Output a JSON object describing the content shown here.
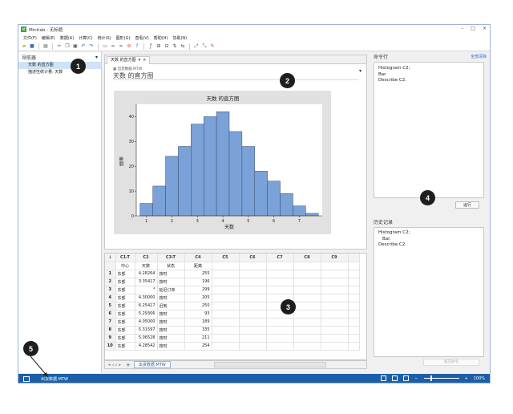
{
  "window": {
    "title": "Minitab - 无标题"
  },
  "menu": [
    "文件(F)",
    "编辑(E)",
    "数据(A)",
    "计算(C)",
    "统计(S)",
    "图形(G)",
    "查看(V)",
    "帮助(H)",
    "协助(N)"
  ],
  "navigator": {
    "title": "导航器",
    "items": [
      "天数 的直方图",
      "描述性统计量: 天数"
    ]
  },
  "output": {
    "tab_label": "天数 的直方图",
    "file_name": "出货数据.MTW",
    "doc_title": "天数 的直方图"
  },
  "chart_data": {
    "type": "bar",
    "title": "天数 的直方图",
    "xlabel": "天数",
    "ylabel": "频率",
    "bin_start": 0.75,
    "bin_width": 0.5,
    "values": [
      5,
      12,
      24,
      28,
      37,
      40,
      42,
      34,
      28,
      18,
      14,
      9,
      4,
      1
    ],
    "xticks": [
      1,
      2,
      3,
      4,
      5,
      6,
      7
    ],
    "yticks": [
      0,
      10,
      20,
      30,
      40
    ],
    "xlim": [
      0.6,
      7.9
    ],
    "ylim": [
      0,
      45
    ],
    "bar_color": "#7aa2d8"
  },
  "worksheet": {
    "columns": [
      "C1-T",
      "C2",
      "C3-T",
      "C4",
      "C5",
      "C6",
      "C7",
      "C8",
      "C9"
    ],
    "names": [
      "中心",
      "天数",
      "状态",
      "距离",
      "",
      "",
      "",
      "",
      ""
    ],
    "rows": [
      {
        "n": "1",
        "c1": "东部",
        "c2": "4.28264",
        "c3": "按时",
        "c4": "255"
      },
      {
        "n": "2",
        "c1": "东部",
        "c2": "3.35417",
        "c3": "按时",
        "c4": "196"
      },
      {
        "n": "3",
        "c1": "东部",
        "c2": "*",
        "c3": "延迟订单",
        "c4": "299"
      },
      {
        "n": "4",
        "c1": "东部",
        "c2": "4.30000",
        "c3": "按时",
        "c4": "205"
      },
      {
        "n": "5",
        "c1": "东部",
        "c2": "6.25417",
        "c3": "迟到",
        "c4": "250"
      },
      {
        "n": "6",
        "c1": "东部",
        "c2": "5.29306",
        "c3": "按时",
        "c4": "93"
      },
      {
        "n": "7",
        "c1": "东部",
        "c2": "4.05000",
        "c3": "按时",
        "c4": "189"
      },
      {
        "n": "8",
        "c1": "东部",
        "c2": "5.31597",
        "c3": "按时",
        "c4": "335"
      },
      {
        "n": "9",
        "c1": "东部",
        "c2": "5.06528",
        "c3": "按时",
        "c4": "211"
      },
      {
        "n": "10",
        "c1": "东部",
        "c2": "4.28542",
        "c3": "按时",
        "c4": "254"
      }
    ],
    "sheet_tab": "出货数据.MTW"
  },
  "command_line": {
    "title": "命令行",
    "clear_label": "全部清除",
    "lines": [
      "Histogram C2;",
      "Bar.",
      "Describe C2."
    ],
    "run_label": "运行"
  },
  "history": {
    "title": "历史记录",
    "lines": [
      "Histogram C2;",
      "  Bar.",
      "Describe C2."
    ],
    "submit_label": "提交命令"
  },
  "status": {
    "project": "出货数据.MTW",
    "zoom": "100%"
  },
  "callouts": [
    "1",
    "2",
    "3",
    "4",
    "5"
  ]
}
